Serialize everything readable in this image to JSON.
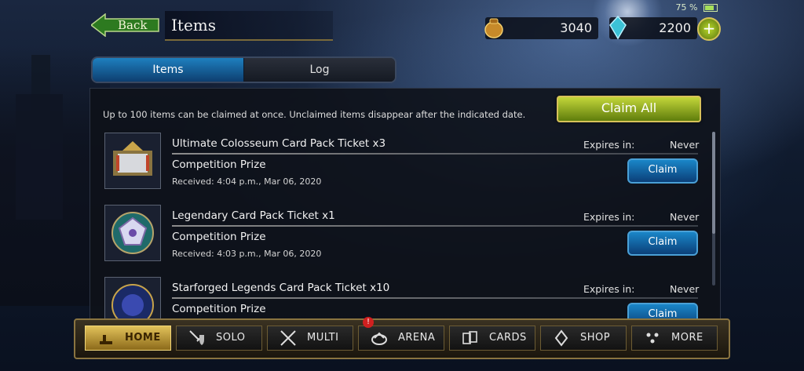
{
  "header": {
    "back_label": "Back",
    "title": "Items",
    "battery_percent": "75 %",
    "gold": "3040",
    "crystals": "2200",
    "plus_label": "+"
  },
  "tabs": [
    {
      "label": "Items",
      "active": true
    },
    {
      "label": "Log",
      "active": false
    }
  ],
  "notice": "Up to 100 items can be claimed at once. Unclaimed items disappear after the indicated date.",
  "claim_all_label": "Claim All",
  "items": [
    {
      "name": "Ultimate Colosseum Card Pack Ticket x3",
      "expires_label": "Expires in:",
      "expires_value": "Never",
      "source": "Competition Prize",
      "received": "Received: 4:04 p.m., Mar 06, 2020",
      "claim_label": "Claim",
      "icon": "colosseum-ticket-icon"
    },
    {
      "name": "Legendary Card Pack Ticket x1",
      "expires_label": "Expires in:",
      "expires_value": "Never",
      "source": "Competition Prize",
      "received": "Received: 4:03 p.m., Mar 06, 2020",
      "claim_label": "Claim",
      "icon": "legendary-pack-icon"
    },
    {
      "name": "Starforged Legends Card Pack Ticket x10",
      "expires_label": "Expires in:",
      "expires_value": "Never",
      "source": "Competition Prize",
      "received": "",
      "claim_label": "Claim",
      "icon": "starforged-pack-icon"
    }
  ],
  "nav": [
    {
      "label": "HOME",
      "icon": "home-icon",
      "active": true
    },
    {
      "label": "SOLO",
      "icon": "sword-shield-icon",
      "active": false
    },
    {
      "label": "MULTI",
      "icon": "crossed-swords-icon",
      "active": false
    },
    {
      "label": "ARENA",
      "icon": "arena-icon",
      "active": false
    },
    {
      "label": "CARDS",
      "icon": "cards-icon",
      "active": false
    },
    {
      "label": "SHOP",
      "icon": "shop-icon",
      "active": false
    },
    {
      "label": "MORE",
      "icon": "more-icon",
      "active": false
    }
  ],
  "arena_alert": "!",
  "colors": {
    "accent_blue": "#1a86c8",
    "claim_all_green": "#c3d63a",
    "gold_trim": "#8a7440"
  }
}
